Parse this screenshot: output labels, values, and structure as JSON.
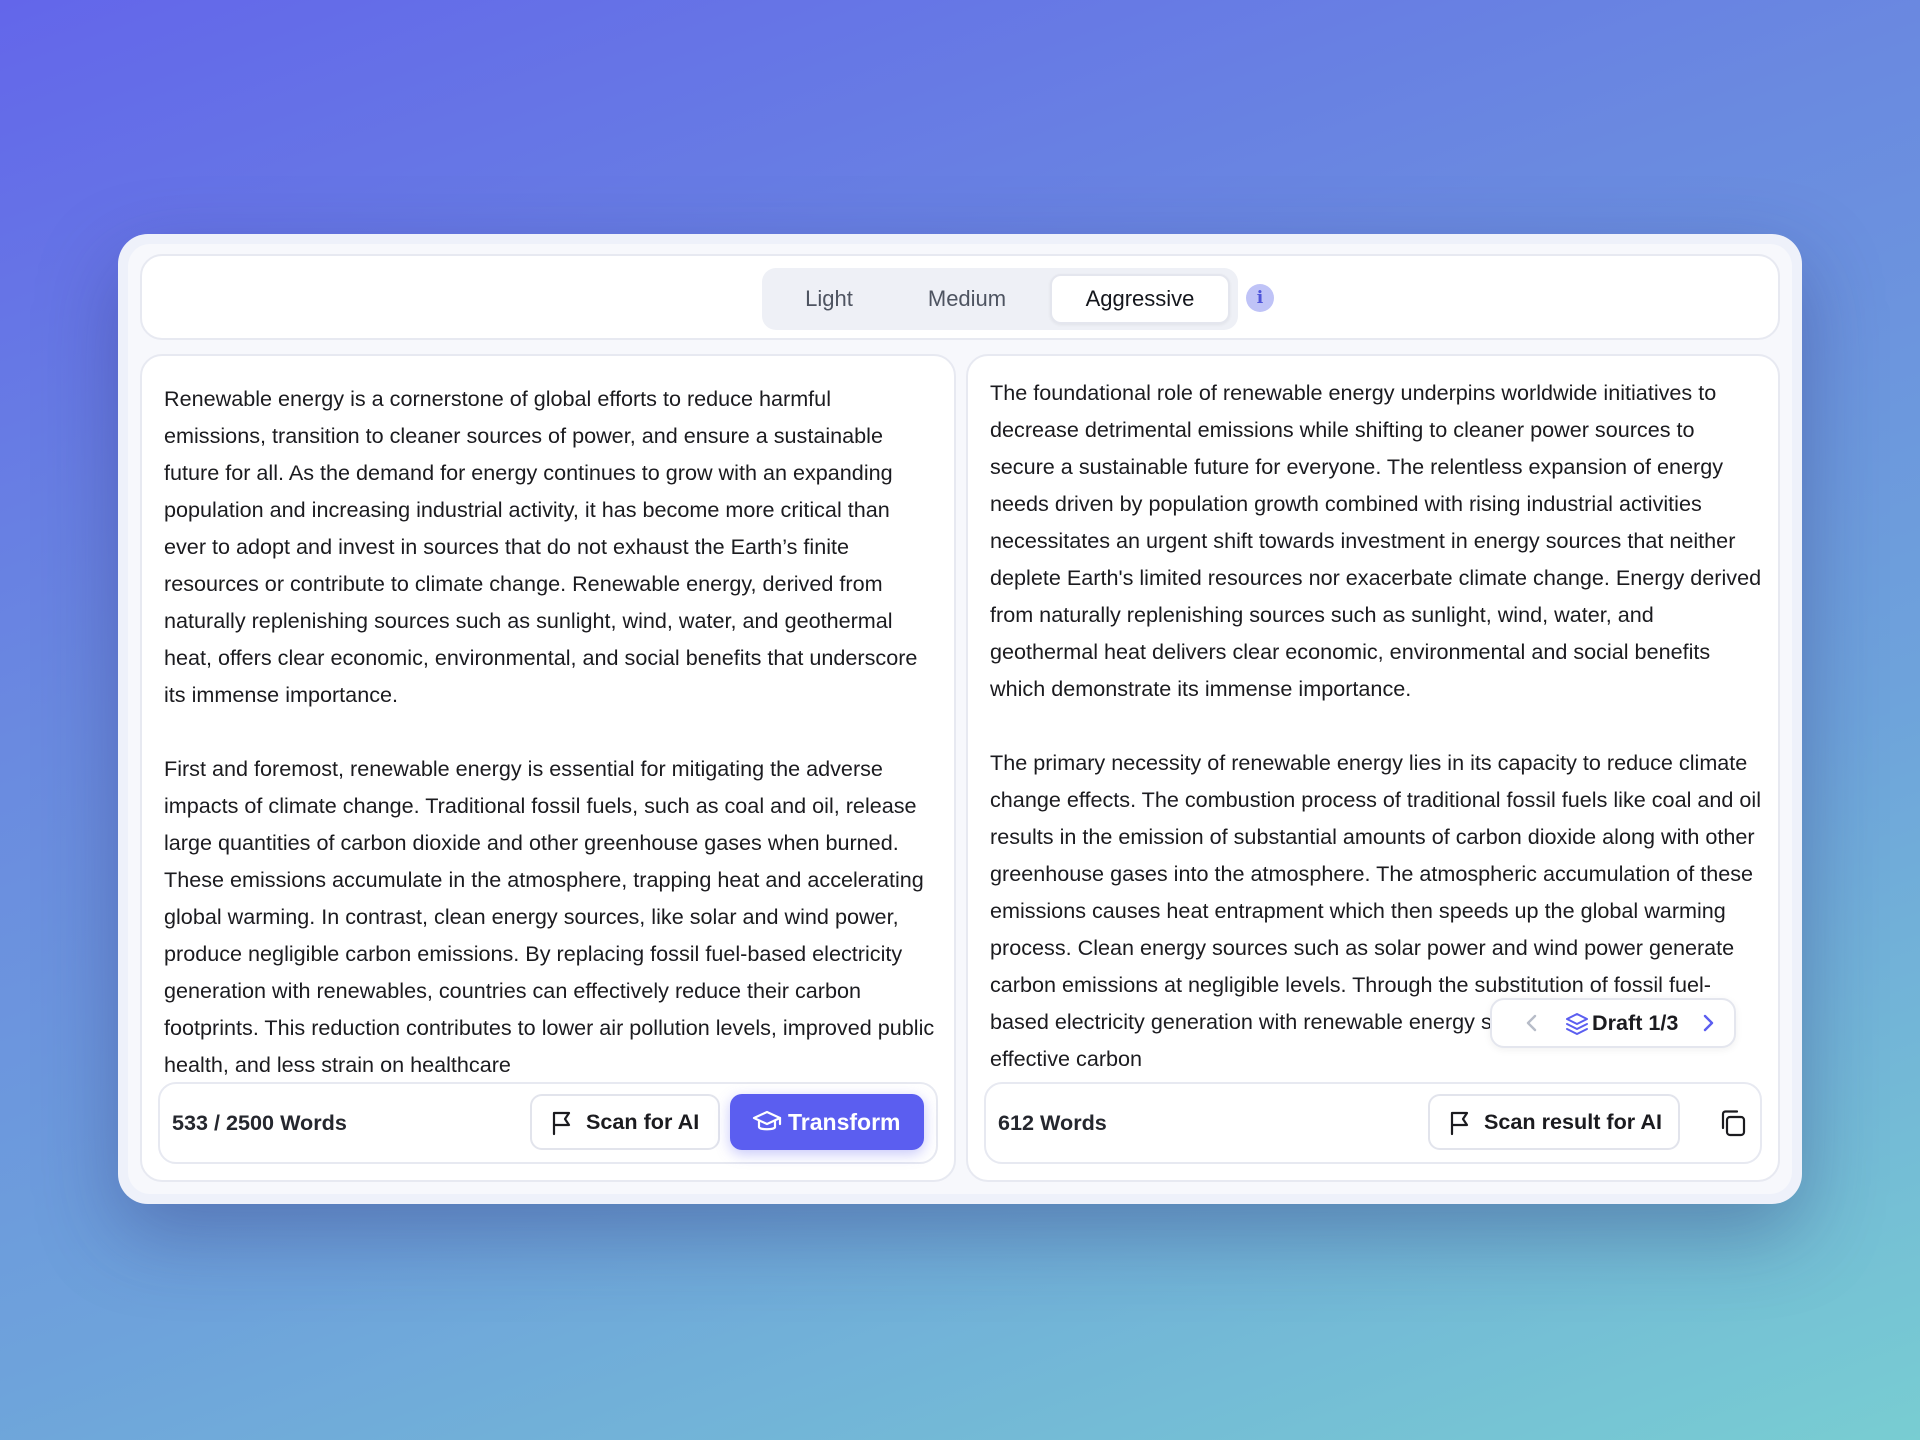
{
  "modes": {
    "light": "Light",
    "medium": "Medium",
    "aggressive": "Aggressive",
    "active": "Aggressive",
    "info": "i"
  },
  "input": {
    "paragraphs": [
      "Renewable energy is a cornerstone of global efforts to reduce harmful emissions, transition to cleaner sources of power, and ensure a sustainable future for all. As the demand for energy continues to grow with an expanding population and increasing industrial activity, it has become more critical than ever to adopt and invest in sources that do not exhaust the Earth’s finite resources or contribute to climate change. Renewable energy, derived from naturally replenishing sources such as sunlight, wind, water, and geothermal heat, offers clear economic, environmental, and social benefits that underscore its immense importance.",
      "First and foremost, renewable energy is essential for mitigating the adverse impacts of climate change. Traditional fossil fuels, such as coal and oil, release large quantities of carbon dioxide and other greenhouse gases when burned. These emissions accumulate in the atmosphere, trapping heat and accelerating global warming. In contrast, clean energy sources, like solar and wind power, produce negligible carbon emissions. By replacing fossil fuel-based electricity generation with renewables, countries can effectively reduce their carbon footprints. This reduction contributes to lower air pollution levels, improved public health, and less strain on healthcare"
    ],
    "word_count": "533 / 2500 Words",
    "scan_label": "Scan for AI",
    "transform_label": "Transform"
  },
  "output": {
    "paragraphs": [
      "The foundational role of renewable energy underpins worldwide initiatives to decrease detrimental emissions while shifting to cleaner power sources to secure a sustainable future for everyone. The relentless expansion of energy needs driven by population growth combined with rising industrial activities necessitates an urgent shift towards investment in energy sources that neither deplete Earth's limited resources nor exacerbate climate change. Energy derived from naturally replenishing sources such as sunlight, wind, water, and geothermal heat delivers clear economic, environmental and social benefits which demonstrate its immense importance.",
      "The primary necessity of renewable energy lies in its capacity to reduce climate change effects. The combustion process of traditional fossil fuels like coal and oil results in the emission of substantial amounts of carbon dioxide along with other greenhouse gases into the atmosphere. The atmospheric accumulation of these emissions causes heat entrapment which then speeds up the global warming process. Clean energy sources such as solar power and wind power generate carbon emissions at negligible levels. Through the substitution of fossil fuel-based electricity generation with renewable energy sources nations achieve effective carbon"
    ],
    "word_count": "612 Words",
    "scan_label": "Scan result for AI",
    "draft_label": "Draft 1/3"
  },
  "colors": {
    "accent": "#5b5ef0",
    "info_bg": "#bfc3f7"
  }
}
